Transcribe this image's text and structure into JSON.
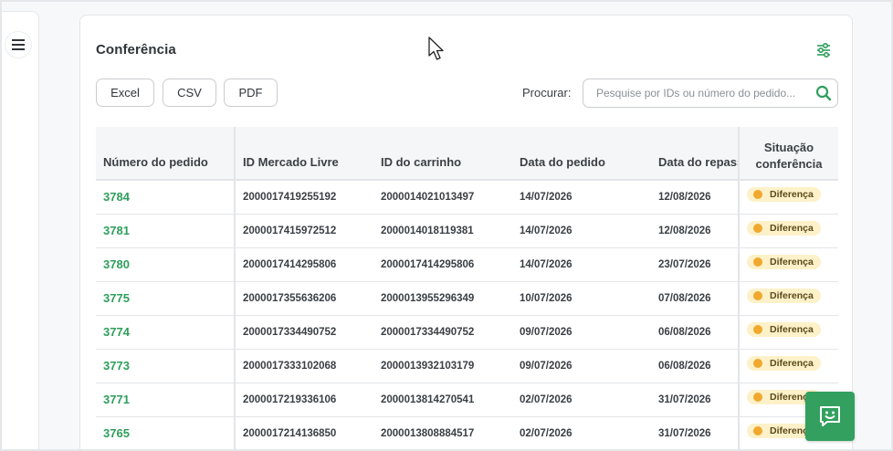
{
  "colors": {
    "accent": "#2e9e5b",
    "chat_button": "#33a05f",
    "badge_bg": "#fdf1c9",
    "badge_dot": "#f0a92e"
  },
  "sidebar": {
    "menu_icon": "hamburger-menu-icon"
  },
  "card": {
    "title": "Conferência",
    "filter_icon": "sliders-icon"
  },
  "toolbar": {
    "excel_label": "Excel",
    "csv_label": "CSV",
    "pdf_label": "PDF",
    "search_label": "Procurar:",
    "search_placeholder": "Pesquise por IDs ou número do pedido...",
    "search_value": ""
  },
  "table": {
    "headers": {
      "order": "Número do pedido",
      "ml_id": "ID Mercado Livre",
      "cart_id": "ID do carrinho",
      "order_date": "Data do pedido",
      "transfer_date": "Data do repasse",
      "status_line1": "Situação",
      "status_line2": "conferência"
    },
    "rows": [
      {
        "order": "3784",
        "ml_id": "2000017419255192",
        "cart_id": "2000014021013497",
        "order_date": "14/07/2026",
        "transfer_date": "12/08/2026",
        "status": "Diferença"
      },
      {
        "order": "3781",
        "ml_id": "2000017415972512",
        "cart_id": "2000014018119381",
        "order_date": "14/07/2026",
        "transfer_date": "12/08/2026",
        "status": "Diferença"
      },
      {
        "order": "3780",
        "ml_id": "2000017414295806",
        "cart_id": "2000017414295806",
        "order_date": "14/07/2026",
        "transfer_date": "23/07/2026",
        "status": "Diferença"
      },
      {
        "order": "3775",
        "ml_id": "2000017355636206",
        "cart_id": "2000013955296349",
        "order_date": "10/07/2026",
        "transfer_date": "07/08/2026",
        "status": "Diferença"
      },
      {
        "order": "3774",
        "ml_id": "2000017334490752",
        "cart_id": "2000017334490752",
        "order_date": "09/07/2026",
        "transfer_date": "06/08/2026",
        "status": "Diferença"
      },
      {
        "order": "3773",
        "ml_id": "2000017333102068",
        "cart_id": "2000013932103179",
        "order_date": "09/07/2026",
        "transfer_date": "06/08/2026",
        "status": "Diferença"
      },
      {
        "order": "3771",
        "ml_id": "2000017219336106",
        "cart_id": "2000013814270541",
        "order_date": "02/07/2026",
        "transfer_date": "31/07/2026",
        "status": "Diferença"
      },
      {
        "order": "3765",
        "ml_id": "2000017214136850",
        "cart_id": "2000013808884517",
        "order_date": "02/07/2026",
        "transfer_date": "31/07/2026",
        "status": "Diferença"
      }
    ]
  },
  "chat": {
    "icon": "chat-smile-icon"
  }
}
